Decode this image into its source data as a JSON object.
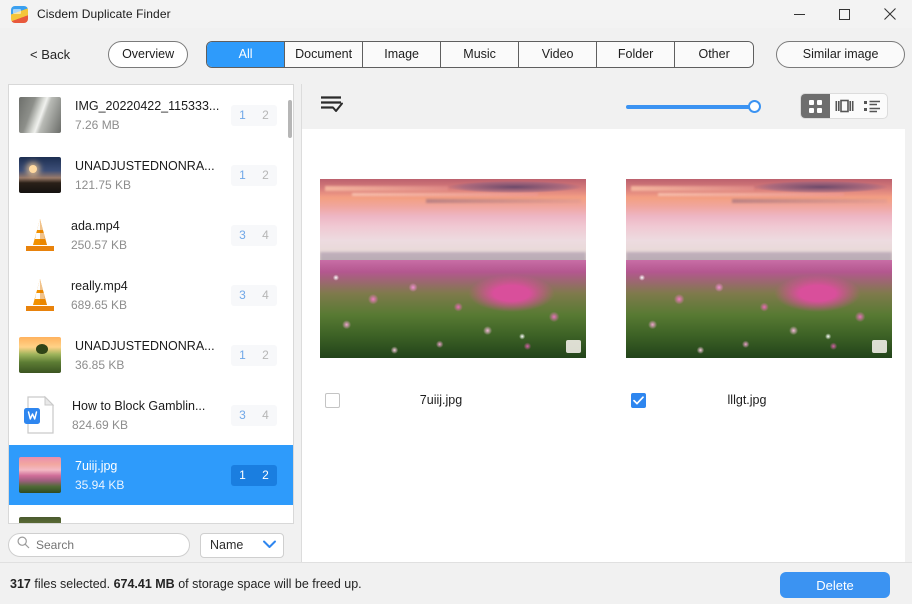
{
  "window": {
    "title": "Cisdem Duplicate Finder",
    "app_icon": "app-logo-icon",
    "minimize": "minimize-icon",
    "maximize": "maximize-icon",
    "close": "close-icon"
  },
  "toolbar": {
    "back_label": "< Back",
    "overview_label": "Overview",
    "similar_image_label": "Similar image",
    "tabs": [
      {
        "label": "All",
        "active": true
      },
      {
        "label": "Document",
        "active": false
      },
      {
        "label": "Image",
        "active": false
      },
      {
        "label": "Music",
        "active": false
      },
      {
        "label": "Video",
        "active": false
      },
      {
        "label": "Folder",
        "active": false
      },
      {
        "label": "Other",
        "active": false
      }
    ],
    "accent_color": "#2e9bfb"
  },
  "sidebar": {
    "items": [
      {
        "name": "IMG_20220422_115333...",
        "size": "7.26 MB",
        "badge1": "1",
        "badge2": "2",
        "icon": "photo-thumbnail-road",
        "selected": false
      },
      {
        "name": "UNADJUSTEDNONRA...",
        "size": "121.75 KB",
        "badge1": "1",
        "badge2": "2",
        "icon": "photo-thumbnail-night",
        "selected": false
      },
      {
        "name": "ada.mp4",
        "size": "250.57 KB",
        "badge1": "3",
        "badge2": "4",
        "icon": "vlc-media-icon",
        "selected": false
      },
      {
        "name": "really.mp4",
        "size": "689.65 KB",
        "badge1": "3",
        "badge2": "4",
        "icon": "vlc-media-icon",
        "selected": false
      },
      {
        "name": "UNADJUSTEDNONRA...",
        "size": "36.85 KB",
        "badge1": "1",
        "badge2": "2",
        "icon": "photo-thumbnail-tree",
        "selected": false
      },
      {
        "name": "How to Block Gamblin...",
        "size": "824.69 KB",
        "badge1": "3",
        "badge2": "4",
        "icon": "word-document-icon",
        "selected": false
      },
      {
        "name": "7uiij.jpg",
        "size": "35.94 KB",
        "badge1": "1",
        "badge2": "2",
        "icon": "photo-thumbnail-flower",
        "selected": true
      }
    ],
    "search": {
      "placeholder": "Search",
      "value": "",
      "icon": "search-icon"
    },
    "sort": {
      "value": "Name",
      "icon": "chevron-down-icon"
    }
  },
  "main": {
    "select_all_icon": "select-all-list-icon",
    "zoom_slider": {
      "value": 92,
      "min": 0,
      "max": 100
    },
    "view_modes": [
      {
        "name": "grid-view",
        "icon": "grid-icon",
        "active": true
      },
      {
        "name": "filmstrip-view",
        "icon": "filmstrip-icon",
        "active": false
      },
      {
        "name": "list-view",
        "icon": "list-icon",
        "active": false
      }
    ],
    "cards": [
      {
        "filename": "7uiij.jpg",
        "checked": false,
        "image": "cosmos-flower-field-sunset"
      },
      {
        "filename": "lllgt.jpg",
        "checked": true,
        "image": "cosmos-flower-field-sunset"
      }
    ]
  },
  "statusbar": {
    "count": "317",
    "count_suffix": "files selected.",
    "size": "674.41 MB",
    "size_suffix": "of storage space will be freed up.",
    "delete_label": "Delete"
  }
}
